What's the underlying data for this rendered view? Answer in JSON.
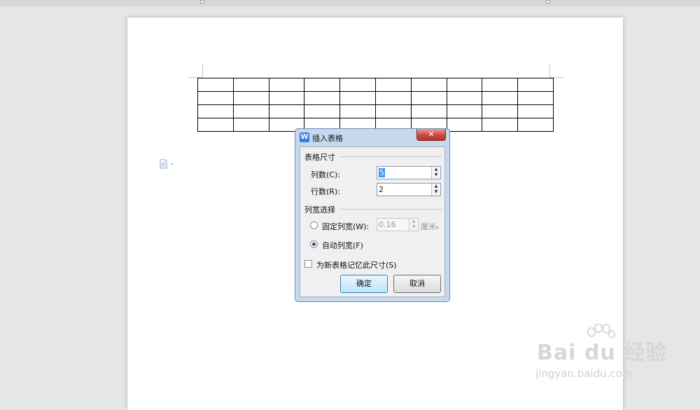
{
  "dialog": {
    "app_icon": "W",
    "title": "插入表格",
    "close_icon": "x-icon",
    "table_size": {
      "group_title": "表格尺寸",
      "columns_label": "列数(C):",
      "columns_value": "5",
      "rows_label": "行数(R):",
      "rows_value": "2"
    },
    "column_width": {
      "group_title": "列宽选择",
      "fixed_label": "固定列宽(W):",
      "fixed_value": "0.16",
      "fixed_unit": "厘米",
      "auto_label": "自动列宽(F)",
      "selected": "auto"
    },
    "remember_label": "为新表格记忆此尺寸(S)",
    "remember_checked": false,
    "ok_label": "确定",
    "cancel_label": "取消"
  },
  "document": {
    "table": {
      "rows": 4,
      "columns": 10
    },
    "paste_icon": "document-icon"
  },
  "watermark": {
    "logo_text": "Bai du 经验",
    "url": "jingyan.baidu.com"
  }
}
